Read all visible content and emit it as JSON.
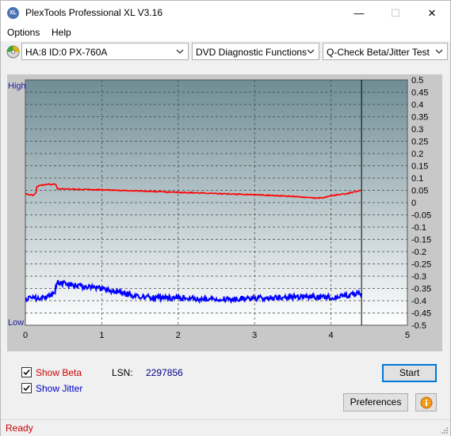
{
  "window": {
    "title": "PlexTools Professional XL V3.16",
    "icon_text": "XL",
    "controls": {
      "minimize": "—",
      "maximize": "☐",
      "close": "✕"
    }
  },
  "menu": {
    "items": [
      "Options",
      "Help"
    ]
  },
  "toolbar": {
    "drive": "HA:8 ID:0  PX-760A",
    "function": "DVD Diagnostic Functions",
    "test": "Q-Check Beta/Jitter Test"
  },
  "chart_data": {
    "type": "line",
    "left_axis": {
      "top_label": "High",
      "bottom_label": "Low"
    },
    "x_ticks": [
      "0",
      "1",
      "2",
      "3",
      "4",
      "5"
    ],
    "xlim": [
      0,
      5
    ],
    "y_ticks": [
      "0.5",
      "0.45",
      "0.4",
      "0.35",
      "0.3",
      "0.25",
      "0.2",
      "0.15",
      "0.1",
      "0.05",
      "0",
      "-0.05",
      "-0.1",
      "-0.15",
      "-0.2",
      "-0.25",
      "-0.3",
      "-0.35",
      "-0.4",
      "-0.45",
      "-0.5"
    ],
    "ylim": [
      -0.5,
      0.5
    ],
    "end_marker_x": 4.4,
    "grid": true,
    "series": [
      {
        "color": "#ff0000",
        "x": [
          0.0,
          0.1,
          0.14,
          0.15,
          0.2,
          0.25,
          0.3,
          0.35,
          0.38,
          0.4,
          0.42,
          0.5,
          0.7,
          1.0,
          1.5,
          2.0,
          2.5,
          3.0,
          3.5,
          3.8,
          3.9,
          4.0,
          4.2,
          4.3,
          4.4
        ],
        "y": [
          0.035,
          0.03,
          0.04,
          0.065,
          0.07,
          0.072,
          0.075,
          0.073,
          0.076,
          0.074,
          0.055,
          0.056,
          0.054,
          0.052,
          0.047,
          0.042,
          0.037,
          0.032,
          0.025,
          0.018,
          0.02,
          0.028,
          0.036,
          0.043,
          0.05
        ]
      },
      {
        "color": "#0000ff",
        "x": [
          0.0,
          0.1,
          0.2,
          0.3,
          0.38,
          0.42,
          0.5,
          0.7,
          1.0,
          1.2,
          1.5,
          2.0,
          2.5,
          3.0,
          3.5,
          4.0,
          4.2,
          4.3,
          4.4
        ],
        "y": [
          -0.395,
          -0.39,
          -0.39,
          -0.385,
          -0.37,
          -0.325,
          -0.33,
          -0.34,
          -0.35,
          -0.365,
          -0.385,
          -0.39,
          -0.395,
          -0.39,
          -0.385,
          -0.385,
          -0.38,
          -0.375,
          -0.37
        ]
      }
    ]
  },
  "controls": {
    "show_beta_label": "Show Beta",
    "show_beta_checked": true,
    "show_jitter_label": "Show Jitter",
    "show_jitter_checked": true,
    "lsn_label": "LSN:",
    "lsn_value": "2297856",
    "start_label": "Start",
    "preferences_label": "Preferences",
    "info_icon": "info-icon"
  },
  "status": {
    "text": "Ready"
  },
  "colors": {
    "beta_label": "#cc0000",
    "jitter_label": "#0000cc",
    "plot_top": "#6f8d96",
    "plot_bottom": "#ffffff"
  }
}
